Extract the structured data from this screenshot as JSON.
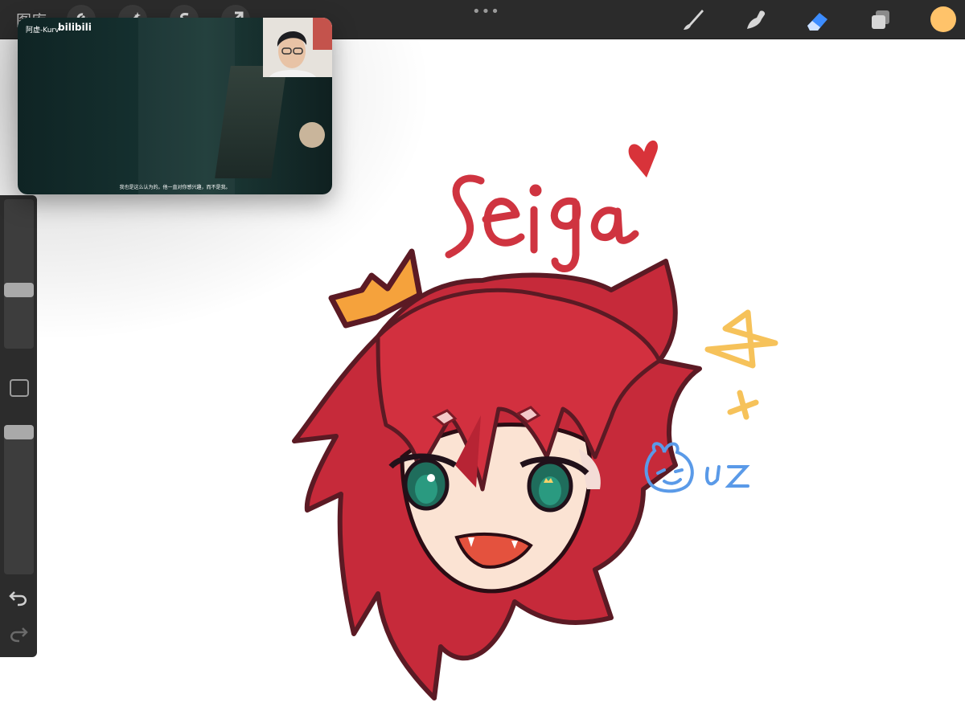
{
  "topbar": {
    "gallery_label": "图库",
    "dots": "•••",
    "icons": {
      "actions": [
        "wrench-icon",
        "magic-wand-icon",
        "selection-s-icon",
        "transform-arrow-icon"
      ],
      "tools": [
        "brush-icon",
        "smudge-icon",
        "eraser-icon",
        "layers-icon"
      ]
    },
    "active_tool": "eraser",
    "current_color": "#ffc36a"
  },
  "sidebar": {
    "brush_size_level": 0.38,
    "opacity_level": 0.0
  },
  "video_overlay": {
    "channel": "阿虚-Kurv",
    "logo": "bilibili",
    "subtitle": "我也是这么认为的。他一直对你感兴趣，而不是我。"
  },
  "artwork": {
    "title_text": "Seiga",
    "signature": "uz"
  },
  "colors": {
    "accent_blue": "#3d8dff",
    "toolbar_bg": "#2b2b2b",
    "hair_red": "#c9283a",
    "crown_orange": "#f5a23c",
    "star_yellow": "#f6c25a"
  }
}
